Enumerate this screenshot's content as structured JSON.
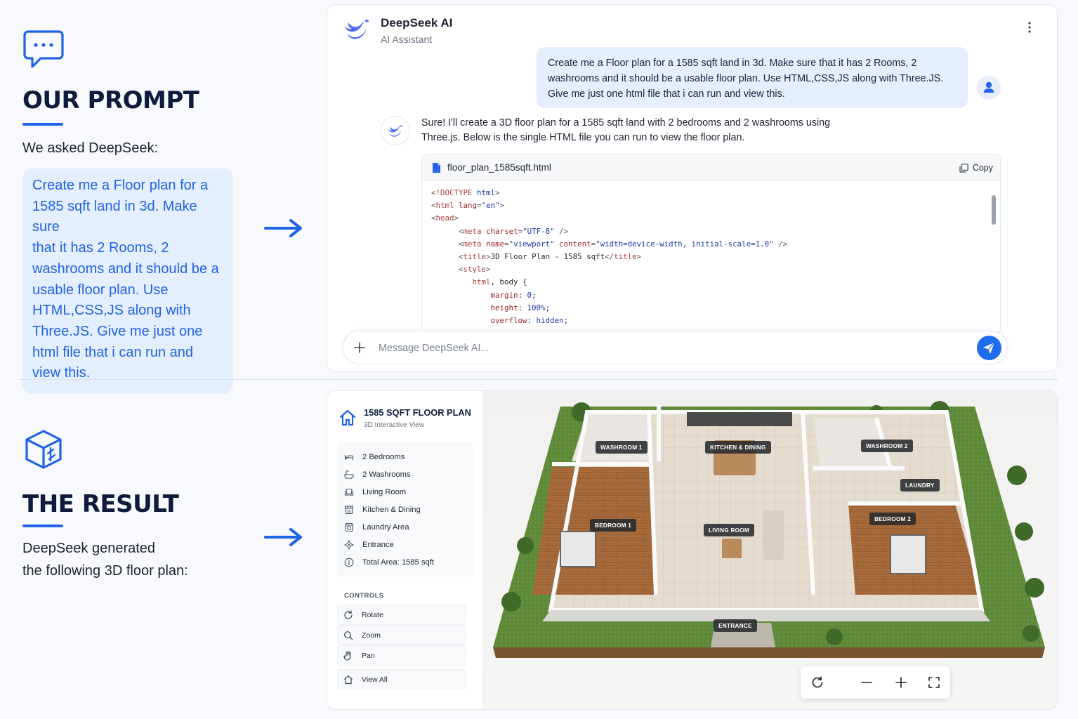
{
  "prompt_section": {
    "heading": "OUR PROMPT",
    "intro": "We asked DeepSeek:",
    "prompt_lines": [
      "Create me a Floor plan for a",
      "1585 sqft land in 3d. Make sure",
      "that it has 2 Rooms, 2",
      "washrooms and it should be a",
      "usable floor plan. Use",
      "HTML,CSS,JS along with",
      "Three.JS. Give me just one",
      "html file that i can run and",
      "view this."
    ],
    "icon": "chat-bubble-icon"
  },
  "result_section": {
    "heading": "THE RESULT",
    "text_lines": [
      "DeepSeek generated",
      "the following 3D floor plan:"
    ],
    "icon": "cube-icon"
  },
  "chat": {
    "app_title": "DeepSeek AI",
    "app_subtitle": "AI Assistant",
    "user_message_lines": [
      "Create me a Floor plan for a 1585 sqft land in 3d. Make sure that it has 2 Rooms, 2",
      "washrooms and it should be a usable floor plan. Use HTML,CSS,JS along with Three.JS.",
      "Give me just one html file that i can run and view this."
    ],
    "bot_message_lines": [
      "Sure! I'll create a 3D floor plan for a 1585 sqft land with 2 bedrooms and 2 washrooms using",
      "Three.js. Below is the single HTML file you can run to view the floor plan."
    ],
    "file_name": "floor_plan_1585sqft.html",
    "copy_label": "Copy",
    "input_placeholder": "Message DeepSeek AI...",
    "input_value": ""
  },
  "plan_panel": {
    "title": "1585 SQFT FLOOR PLAN",
    "subtitle": "3D Interactive View",
    "features": [
      {
        "label": "2 Bedrooms",
        "icon": "bed-icon"
      },
      {
        "label": "2 Washrooms",
        "icon": "bathtub-icon"
      },
      {
        "label": "Living Room",
        "icon": "sofa-icon"
      },
      {
        "label": "Kitchen & Dining",
        "icon": "store-icon"
      },
      {
        "label": "Laundry Area",
        "icon": "washer-icon"
      },
      {
        "label": "Entrance",
        "icon": "compass-icon"
      },
      {
        "label": "Total Area: 1585 sqft",
        "icon": "info-icon"
      }
    ],
    "controls_label": "CONTROLS",
    "controls": [
      {
        "label": "Rotate",
        "icon": "rotate-icon"
      },
      {
        "label": "Zoom",
        "icon": "zoom-icon"
      },
      {
        "label": "Pan",
        "icon": "hand-icon"
      },
      {
        "label": "View All",
        "icon": "home-icon"
      }
    ]
  },
  "room_labels": {
    "washroom1": "WASHROOM 1",
    "kitchen": "KITCHEN & DINING",
    "washroom2": "WASHROOM 2",
    "laundry": "LAUNDRY",
    "bedroom1": "BEDROOM 1",
    "living": "LIVING ROOM",
    "bedroom2": "BEDROOM 2",
    "entrance": "ENTRANCE"
  },
  "colors": {
    "accent": "#1f63e9",
    "prompt_bg": "#e5eefd",
    "heading": "#0f1b3d"
  }
}
